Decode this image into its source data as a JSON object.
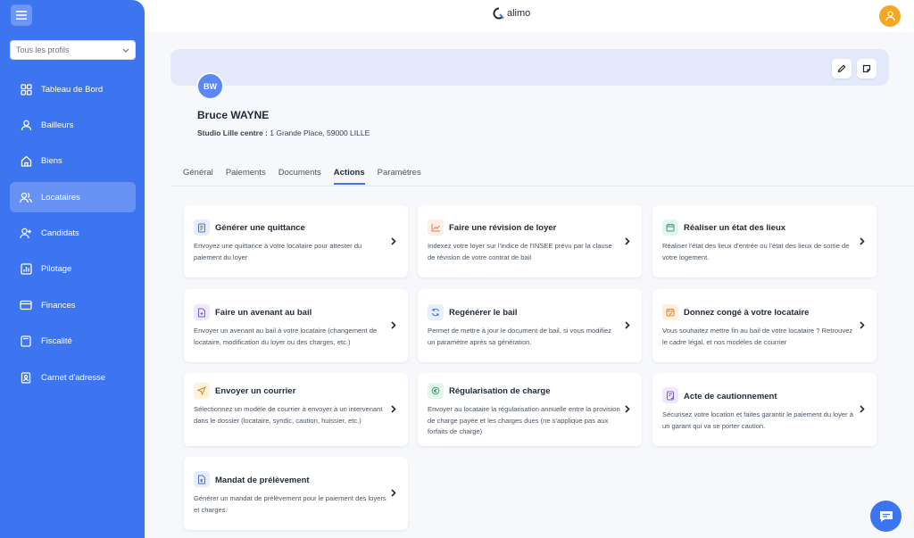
{
  "sidebar": {
    "profile_select": "Tous les profils",
    "items": [
      {
        "label": "Tableau de Bord",
        "icon": "dashboard-icon"
      },
      {
        "label": "Bailleurs",
        "icon": "user-icon"
      },
      {
        "label": "Biens",
        "icon": "home-icon"
      },
      {
        "label": "Locataires",
        "icon": "users-icon",
        "active": true
      },
      {
        "label": "Candidats",
        "icon": "user-plus-icon"
      },
      {
        "label": "Pilotage",
        "icon": "chart-icon"
      },
      {
        "label": "Finances",
        "icon": "card-icon"
      },
      {
        "label": "Fiscalité",
        "icon": "calculator-icon"
      },
      {
        "label": "Carnet d'adresse",
        "icon": "contact-book-icon"
      }
    ]
  },
  "topbar": {
    "logo_text": "alimo"
  },
  "tenant": {
    "initials": "BW",
    "name": "Bruce WAYNE",
    "property_label": "Studio Lille centre :",
    "property_address": "1 Grande Place, 59000 LILLE"
  },
  "tabs": [
    {
      "label": "Général"
    },
    {
      "label": "Paiements"
    },
    {
      "label": "Documents"
    },
    {
      "label": "Actions",
      "active": true
    },
    {
      "label": "Paramètres"
    }
  ],
  "actions": [
    {
      "title": "Générer une quittance",
      "desc": "Envoyez une quittance à votre locataire pour attester du paiement du loyer",
      "icon": "receipt-icon",
      "color": "#e8edfb"
    },
    {
      "title": "Faire une révision de loyer",
      "desc": "Indexez votre loyer sur l'indice de l'INSEE prévu par la clause de révision de votre contrat de bail",
      "icon": "trend-icon",
      "color": "#fdeee6"
    },
    {
      "title": "Réaliser un état des lieux",
      "desc": "Réaliser l'état des lieux d'entrée ou l'état des lieux de sortie de votre logement.",
      "icon": "calendar-icon",
      "color": "#e3f5ec"
    },
    {
      "title": "Faire un avenant au bail",
      "desc": "Envoyer un avenant au bail à votre locataire (changement de locataire, modification du loyer ou des charges, etc.)",
      "icon": "doc-plus-icon",
      "color": "#efe9fb"
    },
    {
      "title": "Regénérer le bail",
      "desc": "Permet de mettre à jour le document de bail, si vous modifiez un paramètre après sa génération.",
      "icon": "refresh-icon",
      "color": "#e6f0fb"
    },
    {
      "title": "Donnez congé à votre locataire",
      "desc": "Vous souhaitez mettre fin au bail de votre locataire ? Retrouvez le cadre légal, et nos modèles de courrier",
      "icon": "calendar-check-icon",
      "color": "#fdf0e0"
    },
    {
      "title": "Envoyer un courrier",
      "desc": "Sélectionnez un modèle de courrier à envoyer à un intervenant dans le dossier (locataire, syndic, caution, huissier, etc.)",
      "icon": "send-icon",
      "color": "#fdf3dd"
    },
    {
      "title": "Régularisation de charge",
      "desc": "Envoyer au locataire la régularisation annuelle entre la provision de charge payée et les charges dues (ne s'applique pas aux forfaits de charge)",
      "icon": "settings-coin-icon",
      "color": "#e3f5ec"
    },
    {
      "title": "Acte de cautionnement",
      "desc": "Sécurisez votre location et faites garantir le paiement du loyer à un garant qui va se porter caution.",
      "icon": "contract-icon",
      "color": "#efe9fb"
    },
    {
      "title": "Mandat de prélèvement",
      "desc": "Générer un mandat de prélèvement pour le paiement des loyers et charges.",
      "icon": "doc-euro-icon",
      "color": "#e8edfb"
    }
  ],
  "colors": {
    "primary": "#3d74f0",
    "avatar_user": "#f5a623"
  }
}
